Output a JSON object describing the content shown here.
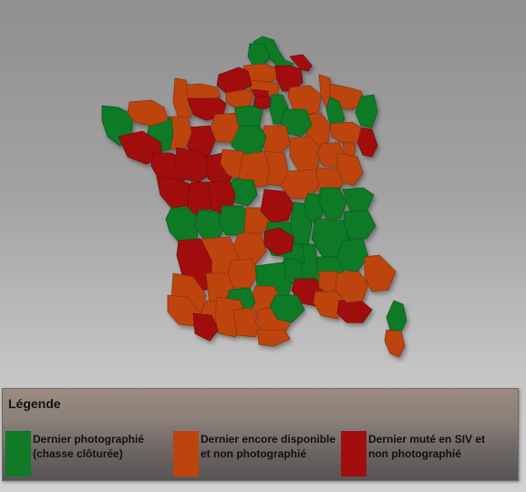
{
  "legend": {
    "title": "Légende",
    "items": [
      {
        "label": "Dernier photographié (chasse clôturée)",
        "color": "#117a27"
      },
      {
        "label": "Dernier encore disponible et non photographié",
        "color": "#bd440d"
      },
      {
        "label": "Dernier muté en SIV et non photographié",
        "color": "#a10e0e"
      }
    ]
  },
  "map": {
    "region": "France",
    "departements": [
      {
        "code": "59",
        "status": "green"
      },
      {
        "code": "62",
        "status": "green"
      },
      {
        "code": "80",
        "status": "orange"
      },
      {
        "code": "02",
        "status": "red"
      },
      {
        "code": "08",
        "status": "red"
      },
      {
        "code": "60",
        "status": "orange"
      },
      {
        "code": "76",
        "status": "red"
      },
      {
        "code": "27",
        "status": "orange"
      },
      {
        "code": "14",
        "status": "orange"
      },
      {
        "code": "50",
        "status": "orange"
      },
      {
        "code": "61",
        "status": "red"
      },
      {
        "code": "95",
        "status": "red"
      },
      {
        "code": "75",
        "status": "red"
      },
      {
        "code": "77",
        "status": "green"
      },
      {
        "code": "78",
        "status": "green"
      },
      {
        "code": "51",
        "status": "orange"
      },
      {
        "code": "55",
        "status": "orange"
      },
      {
        "code": "57",
        "status": "orange"
      },
      {
        "code": "54",
        "status": "green"
      },
      {
        "code": "67",
        "status": "green"
      },
      {
        "code": "68",
        "status": "red"
      },
      {
        "code": "88",
        "status": "orange"
      },
      {
        "code": "52",
        "status": "orange"
      },
      {
        "code": "10",
        "status": "green"
      },
      {
        "code": "89",
        "status": "orange"
      },
      {
        "code": "21",
        "status": "orange"
      },
      {
        "code": "70",
        "status": "orange"
      },
      {
        "code": "90",
        "status": "orange"
      },
      {
        "code": "25",
        "status": "orange"
      },
      {
        "code": "39",
        "status": "orange"
      },
      {
        "code": "71",
        "status": "orange"
      },
      {
        "code": "58",
        "status": "orange"
      },
      {
        "code": "45",
        "status": "green"
      },
      {
        "code": "28",
        "status": "orange"
      },
      {
        "code": "72",
        "status": "red"
      },
      {
        "code": "53",
        "status": "orange"
      },
      {
        "code": "35",
        "status": "green"
      },
      {
        "code": "29",
        "status": "green"
      },
      {
        "code": "22",
        "status": "orange"
      },
      {
        "code": "56",
        "status": "red"
      },
      {
        "code": "44",
        "status": "red"
      },
      {
        "code": "49",
        "status": "red"
      },
      {
        "code": "37",
        "status": "red"
      },
      {
        "code": "41",
        "status": "orange"
      },
      {
        "code": "18",
        "status": "orange"
      },
      {
        "code": "36",
        "status": "green"
      },
      {
        "code": "86",
        "status": "red"
      },
      {
        "code": "79",
        "status": "red"
      },
      {
        "code": "85",
        "status": "red"
      },
      {
        "code": "17",
        "status": "green"
      },
      {
        "code": "16",
        "status": "green"
      },
      {
        "code": "87",
        "status": "green"
      },
      {
        "code": "23",
        "status": "orange"
      },
      {
        "code": "03",
        "status": "red"
      },
      {
        "code": "63",
        "status": "green"
      },
      {
        "code": "42",
        "status": "green"
      },
      {
        "code": "69",
        "status": "green"
      },
      {
        "code": "01",
        "status": "green"
      },
      {
        "code": "74",
        "status": "green"
      },
      {
        "code": "73",
        "status": "green"
      },
      {
        "code": "38",
        "status": "green"
      },
      {
        "code": "26",
        "status": "green"
      },
      {
        "code": "07",
        "status": "green"
      },
      {
        "code": "43",
        "status": "green"
      },
      {
        "code": "15",
        "status": "red"
      },
      {
        "code": "19",
        "status": "orange"
      },
      {
        "code": "24",
        "status": "orange"
      },
      {
        "code": "33",
        "status": "red"
      },
      {
        "code": "40",
        "status": "orange"
      },
      {
        "code": "47",
        "status": "orange"
      },
      {
        "code": "46",
        "status": "orange"
      },
      {
        "code": "12",
        "status": "green"
      },
      {
        "code": "48",
        "status": "green"
      },
      {
        "code": "30",
        "status": "red"
      },
      {
        "code": "84",
        "status": "orange"
      },
      {
        "code": "13",
        "status": "orange"
      },
      {
        "code": "83",
        "status": "red"
      },
      {
        "code": "04",
        "status": "orange"
      },
      {
        "code": "05",
        "status": "green"
      },
      {
        "code": "06",
        "status": "orange"
      },
      {
        "code": "81",
        "status": "orange"
      },
      {
        "code": "82",
        "status": "green"
      },
      {
        "code": "32",
        "status": "orange"
      },
      {
        "code": "64",
        "status": "orange"
      },
      {
        "code": "65",
        "status": "red"
      },
      {
        "code": "31",
        "status": "orange"
      },
      {
        "code": "09",
        "status": "orange"
      },
      {
        "code": "11",
        "status": "orange"
      },
      {
        "code": "66",
        "status": "orange"
      },
      {
        "code": "34",
        "status": "green"
      },
      {
        "code": "2B",
        "status": "green"
      },
      {
        "code": "2A",
        "status": "orange"
      }
    ]
  },
  "colors": {
    "green": "#117a27",
    "orange": "#bd440d",
    "red": "#a10e0e",
    "green_stroke": "#0b5a1c",
    "orange_stroke": "#8e3409",
    "red_stroke": "#760707"
  }
}
